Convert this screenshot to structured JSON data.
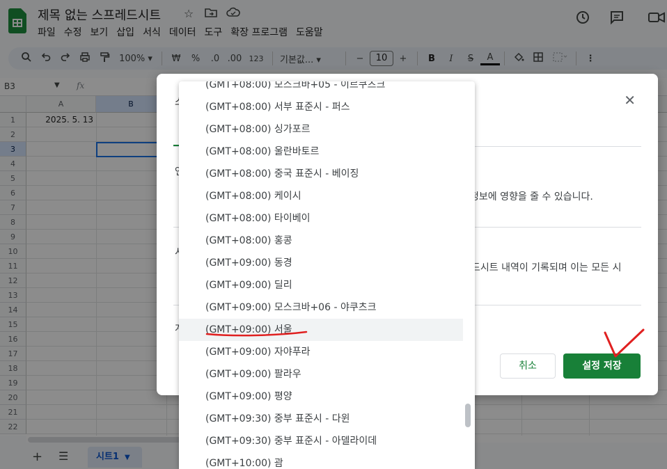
{
  "doc": {
    "title": "제목 없는 스프레드시트"
  },
  "menu": [
    "파일",
    "수정",
    "보기",
    "삽입",
    "서식",
    "데이터",
    "도구",
    "확장 프로그램",
    "도움말"
  ],
  "icons": {
    "star": "star-icon",
    "move": "folder-move-icon",
    "cloud": "cloud-status-icon",
    "history": "history-icon",
    "comment": "comment-icon",
    "meet": "video-icon"
  },
  "toolbar": {
    "zoom": "100%",
    "currency": "₩",
    "percent": "%",
    "dec_decrease": ".0",
    "dec_increase": ".00",
    "format_number": "123",
    "font": "기본값...",
    "font_size": "10"
  },
  "formula_bar": {
    "name_box": "B3",
    "fx": "fx"
  },
  "grid": {
    "columns": [
      "A",
      "B"
    ],
    "rows": [
      "1",
      "2",
      "3",
      "4",
      "5",
      "6",
      "7",
      "8",
      "9",
      "10",
      "11",
      "12",
      "13",
      "14",
      "15",
      "16",
      "17",
      "18",
      "19",
      "20",
      "21",
      "22"
    ],
    "selected_row": "3",
    "selected_col": "B",
    "a1_value": "2025. 5. 13"
  },
  "bottom": {
    "sheet_name": "시트1"
  },
  "dialog": {
    "header_fragment": "스",
    "line1": "정보에 영향을 줄 수 있습니다.",
    "line2": "드시트 내역이 기록되며 이는 모든 시",
    "frag1": "언",
    "frag2": "시",
    "frag3": "계",
    "cancel": "취소",
    "save": "설정 저장"
  },
  "timezones": [
    "(GMT+08:00) 모스크바+05 - 이르쿠츠크",
    "(GMT+08:00) 서부 표준시 - 퍼스",
    "(GMT+08:00) 싱가포르",
    "(GMT+08:00) 울란바토르",
    "(GMT+08:00) 중국 표준시 - 베이징",
    "(GMT+08:00) 케이시",
    "(GMT+08:00) 타이베이",
    "(GMT+08:00) 홍콩",
    "(GMT+09:00) 동경",
    "(GMT+09:00) 딜리",
    "(GMT+09:00) 모스크바+06 - 야쿠츠크",
    "(GMT+09:00) 서울",
    "(GMT+09:00) 자야푸라",
    "(GMT+09:00) 팔라우",
    "(GMT+09:00) 평양",
    "(GMT+09:30) 중부 표준시 - 다윈",
    "(GMT+09:30) 중부 표준시 - 아델라이데",
    "(GMT+10:00) 괌"
  ],
  "highlighted_timezone": "(GMT+09:00) 서울",
  "colors": {
    "accent_green": "#188038",
    "annotation_red": "#e02020",
    "selection_blue": "#1a73e8"
  }
}
